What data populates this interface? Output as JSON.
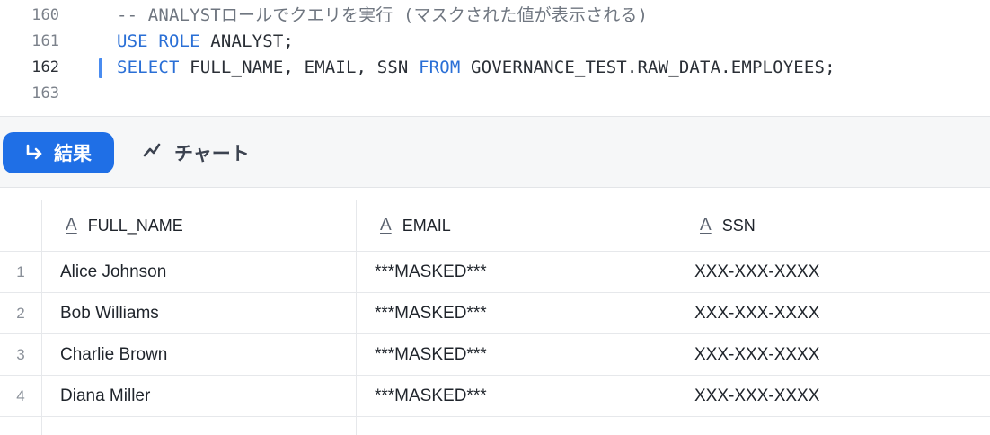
{
  "editor": {
    "lines": [
      {
        "number": "160",
        "text": "-- ANALYSTロールでクエリを実行 (マスクされた値が表示される)"
      },
      {
        "number": "161",
        "kw1": "USE ROLE",
        "rest": " ANALYST;"
      },
      {
        "number": "162",
        "kw1": "SELECT",
        "mid": " FULL_NAME, EMAIL, SSN ",
        "kw2": "FROM",
        "rest": " GOVERNANCE_TEST.RAW_DATA.EMPLOYEES;"
      },
      {
        "number": "163"
      }
    ]
  },
  "toolbar": {
    "results_label": "結果",
    "chart_label": "チャート",
    "results_icon": "return-arrow-icon",
    "chart_icon": "line-chart-icon",
    "accent_color": "#1f6fe6"
  },
  "table": {
    "columns": [
      {
        "type_icon": "A",
        "name": "FULL_NAME"
      },
      {
        "type_icon": "A",
        "name": "EMAIL"
      },
      {
        "type_icon": "A",
        "name": "SSN"
      }
    ],
    "rows": [
      {
        "index": "1",
        "full_name": "Alice Johnson",
        "email": "***MASKED***",
        "ssn": "XXX-XXX-XXXX"
      },
      {
        "index": "2",
        "full_name": "Bob Williams",
        "email": "***MASKED***",
        "ssn": "XXX-XXX-XXXX"
      },
      {
        "index": "3",
        "full_name": "Charlie Brown",
        "email": "***MASKED***",
        "ssn": "XXX-XXX-XXXX"
      },
      {
        "index": "4",
        "full_name": "Diana Miller",
        "email": "***MASKED***",
        "ssn": "XXX-XXX-XXXX"
      }
    ]
  }
}
